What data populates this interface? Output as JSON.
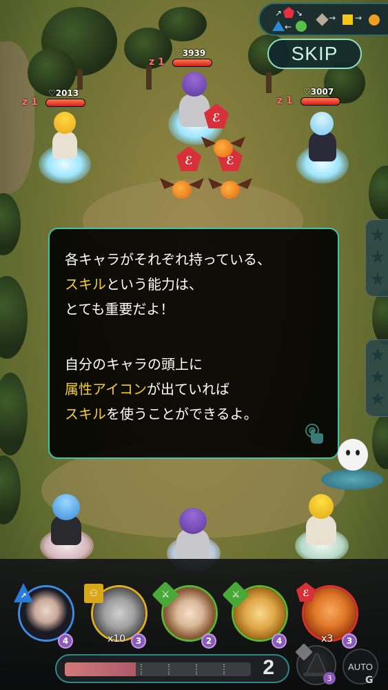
{
  "top_panel": {
    "element_cycle_icon": "element-cycle-triangle-pentagon-circle",
    "element_order_icon": "element-order-diamond-square-circle"
  },
  "skip_button": {
    "label": "SKIP"
  },
  "enemies": [
    {
      "level": "1",
      "hp": "2013",
      "hp_fraction": 1.0
    },
    {
      "level": "1",
      "hp": "3939",
      "hp_fraction": 1.0
    },
    {
      "level": "1",
      "hp": "3007",
      "hp_fraction": 1.0
    }
  ],
  "dialog": {
    "line1": "各キャラがそれぞれ持っている、",
    "line2_highlight": "スキル",
    "line2_rest": "という能力は、",
    "line3": "とても重要だよ！",
    "line4": "自分のキャラの頭上に",
    "line5_highlight": "属性アイコン",
    "line5_rest": "が出ていれば",
    "line6_highlight": "スキル",
    "line6_rest": "を使うことができるよ。",
    "tap_icon": "tap-hand-icon"
  },
  "party": [
    {
      "ring": "blue",
      "badge_icon": "archer-arrow-icon",
      "level": "4",
      "count": ""
    },
    {
      "ring": "yellow",
      "badge_icon": "summon-group-icon",
      "level": "3",
      "count": "x10"
    },
    {
      "ring": "green",
      "badge_icon": "sword-icon",
      "level": "2",
      "count": ""
    },
    {
      "ring": "green",
      "badge_icon": "sword-icon",
      "level": "4",
      "count": ""
    },
    {
      "ring": "red",
      "badge_icon": "wing-icon",
      "level": "3",
      "count": "x3"
    }
  ],
  "gauge": {
    "value": "2",
    "fill_fraction": 0.38
  },
  "special": {
    "level": "3"
  },
  "auto_button": {
    "label": "AUTO"
  },
  "colors": {
    "accent": "#3cc6b0",
    "highlight_text": "#f6d02a",
    "hp_red": "#d42018",
    "fire": "#d83038",
    "water": "#2a7ad8",
    "wind": "#48a838",
    "light": "#d8a818"
  }
}
